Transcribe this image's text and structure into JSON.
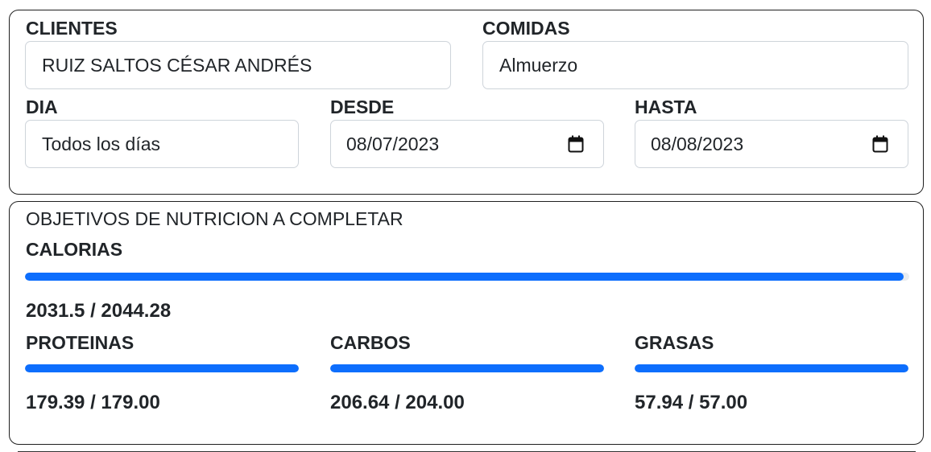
{
  "filters": {
    "clientes_label": "CLIENTES",
    "clientes_value": "RUIZ SALTOS CÉSAR ANDRÉS",
    "comidas_label": "COMIDAS",
    "comidas_value": "Almuerzo",
    "dia_label": "DIA",
    "dia_value": "Todos los días",
    "desde_label": "DESDE",
    "desde_value": "08/07/2023",
    "hasta_label": "HASTA",
    "hasta_value": "08/08/2023",
    "date_icon": "calendar-icon"
  },
  "goals": {
    "title": "OBJETIVOS DE NUTRICION A COMPLETAR",
    "accent_color": "#0d6efd",
    "calorias": {
      "label": "CALORIAS",
      "text": "2031.5 / 2044.28",
      "current": 2031.5,
      "target": 2044.28
    },
    "proteinas": {
      "label": "PROTEINAS",
      "text": "179.39 / 179.00",
      "current": 179.39,
      "target": 179.0
    },
    "carbos": {
      "label": "CARBOS",
      "text": "206.64 / 204.00",
      "current": 206.64,
      "target": 204.0
    },
    "grasas": {
      "label": "GRASAS",
      "text": "57.94 / 57.00",
      "current": 57.94,
      "target": 57.0
    }
  }
}
